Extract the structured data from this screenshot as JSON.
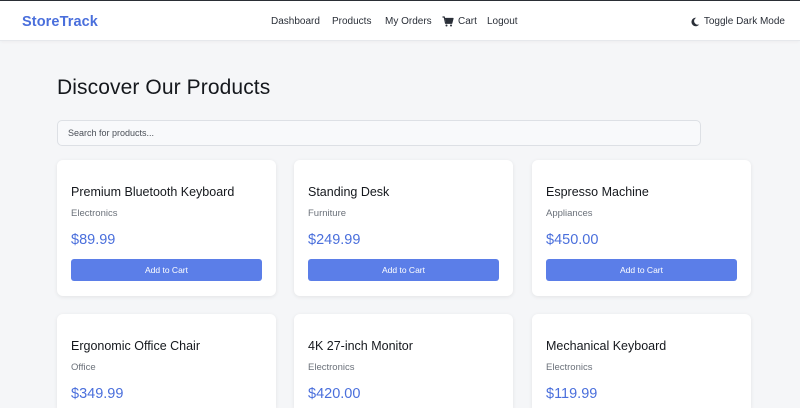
{
  "navbar": {
    "brand": "StoreTrack",
    "links": [
      "Dashboard",
      "Products",
      "My Orders",
      "Cart",
      "Logout"
    ],
    "dark_mode_label": "Toggle Dark Mode"
  },
  "main": {
    "title": "Discover Our Products",
    "search_placeholder": "Search for products...",
    "add_to_cart_label": "Add to Cart",
    "products": [
      {
        "name": "Premium Bluetooth Keyboard",
        "category": "Electronics",
        "price": "$89.99"
      },
      {
        "name": "Standing Desk",
        "category": "Furniture",
        "price": "$249.99"
      },
      {
        "name": "Espresso Machine",
        "category": "Appliances",
        "price": "$450.00"
      },
      {
        "name": "Ergonomic Office Chair",
        "category": "Office",
        "price": "$349.99"
      },
      {
        "name": "4K 27-inch Monitor",
        "category": "Electronics",
        "price": "$420.00"
      },
      {
        "name": "Mechanical Keyboard",
        "category": "Electronics",
        "price": "$119.99"
      }
    ]
  },
  "icons": {
    "cart": "cart-icon",
    "dark_mode": "moon-icon"
  },
  "colors": {
    "brand": "#4a6fdc",
    "button": "#5b7ee8",
    "background": "#f5f6f8"
  }
}
